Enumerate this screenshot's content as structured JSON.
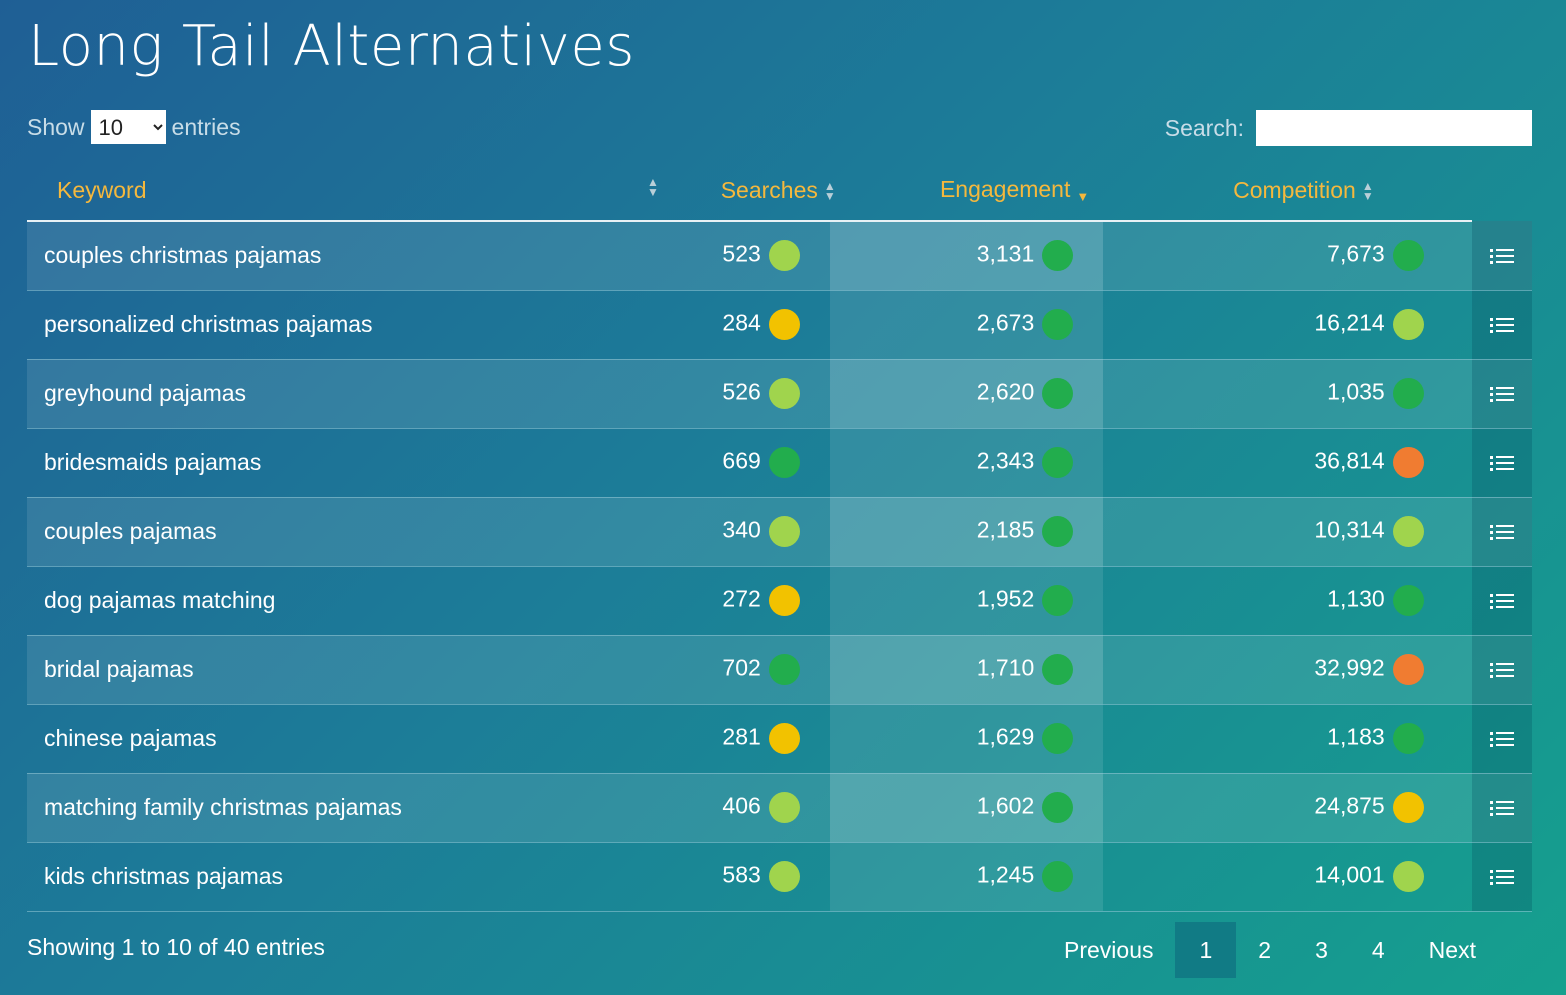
{
  "title": "Long Tail Alternatives",
  "length_control": {
    "prefix": "Show",
    "value": "10",
    "suffix": "entries"
  },
  "search": {
    "label": "Search:",
    "value": ""
  },
  "columns": [
    {
      "label": "Keyword",
      "sort": "both"
    },
    {
      "label": "Searches",
      "sort": "both"
    },
    {
      "label": "Engagement",
      "sort": "desc"
    },
    {
      "label": "Competition",
      "sort": "both"
    }
  ],
  "colors": {
    "dark_green": "#22ad4d",
    "light_green": "#a0d44d",
    "yellow": "#f2c200",
    "orange": "#f07c31",
    "header_text": "#f5b83d"
  },
  "rows": [
    {
      "keyword": "couples christmas pajamas",
      "searches": "523",
      "searches_level": "light_green",
      "engagement": "3,131",
      "engagement_level": "dark_green",
      "competition": "7,673",
      "competition_level": "dark_green"
    },
    {
      "keyword": "personalized christmas pajamas",
      "searches": "284",
      "searches_level": "yellow",
      "engagement": "2,673",
      "engagement_level": "dark_green",
      "competition": "16,214",
      "competition_level": "light_green"
    },
    {
      "keyword": "greyhound pajamas",
      "searches": "526",
      "searches_level": "light_green",
      "engagement": "2,620",
      "engagement_level": "dark_green",
      "competition": "1,035",
      "competition_level": "dark_green"
    },
    {
      "keyword": "bridesmaids pajamas",
      "searches": "669",
      "searches_level": "dark_green",
      "engagement": "2,343",
      "engagement_level": "dark_green",
      "competition": "36,814",
      "competition_level": "orange"
    },
    {
      "keyword": "couples pajamas",
      "searches": "340",
      "searches_level": "light_green",
      "engagement": "2,185",
      "engagement_level": "dark_green",
      "competition": "10,314",
      "competition_level": "light_green"
    },
    {
      "keyword": "dog pajamas matching",
      "searches": "272",
      "searches_level": "yellow",
      "engagement": "1,952",
      "engagement_level": "dark_green",
      "competition": "1,130",
      "competition_level": "dark_green"
    },
    {
      "keyword": "bridal pajamas",
      "searches": "702",
      "searches_level": "dark_green",
      "engagement": "1,710",
      "engagement_level": "dark_green",
      "competition": "32,992",
      "competition_level": "orange"
    },
    {
      "keyword": "chinese pajamas",
      "searches": "281",
      "searches_level": "yellow",
      "engagement": "1,629",
      "engagement_level": "dark_green",
      "competition": "1,183",
      "competition_level": "dark_green"
    },
    {
      "keyword": "matching family christmas pajamas",
      "searches": "406",
      "searches_level": "light_green",
      "engagement": "1,602",
      "engagement_level": "dark_green",
      "competition": "24,875",
      "competition_level": "yellow"
    },
    {
      "keyword": "kids christmas pajamas",
      "searches": "583",
      "searches_level": "light_green",
      "engagement": "1,245",
      "engagement_level": "dark_green",
      "competition": "14,001",
      "competition_level": "light_green"
    }
  ],
  "row_action_icon": "list-icon",
  "info": "Showing 1 to 10 of 40 entries",
  "pagination": {
    "previous": "Previous",
    "pages": [
      "1",
      "2",
      "3",
      "4"
    ],
    "current": "1",
    "next": "Next"
  }
}
